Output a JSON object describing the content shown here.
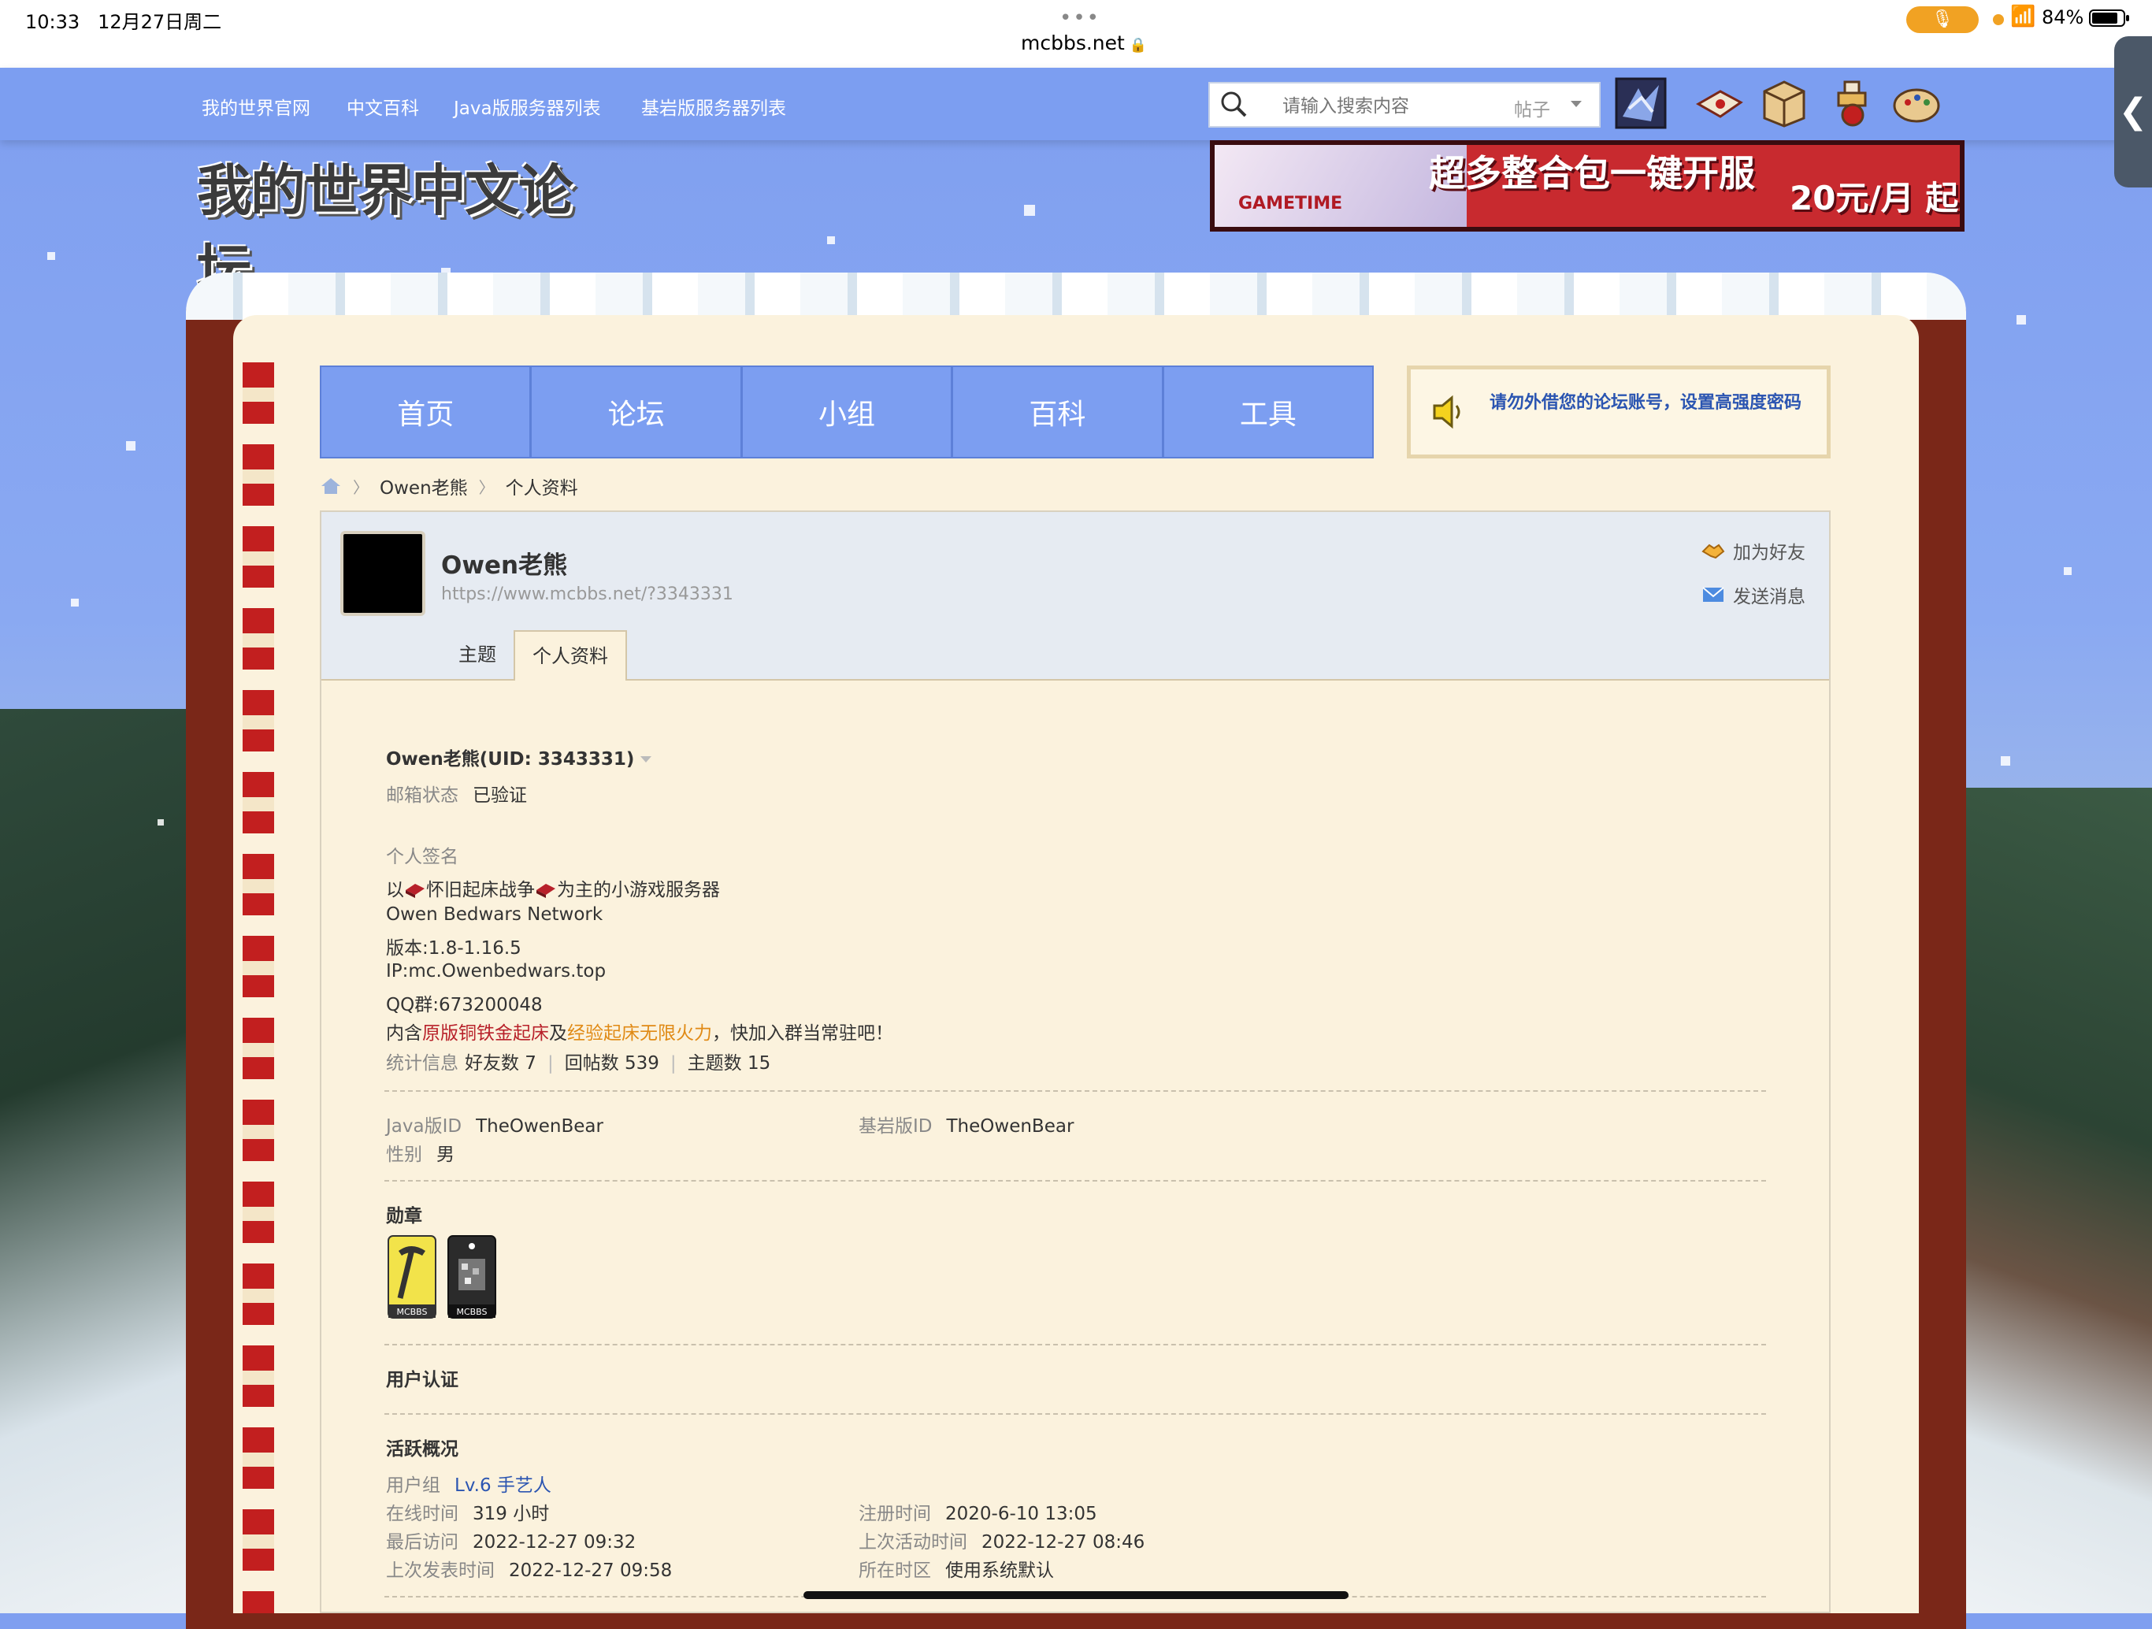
{
  "status_bar": {
    "time": "10:33",
    "date": "12月27日周二",
    "url": "mcbbs.net",
    "battery": "84%",
    "battery_fraction": 0.84
  },
  "top_nav": {
    "links": [
      "我的世界官网",
      "中文百科",
      "Java版服务器列表",
      "基岩版服务器列表"
    ],
    "search_placeholder": "请输入搜索内容",
    "search_type": "帖子"
  },
  "side_tab_glyph": "❮",
  "logo_text": "我的世界中文论坛",
  "banner": {
    "brand": "GAMETIME",
    "headline": "超多整合包一键开服",
    "price": "20元/月 起"
  },
  "main_tabs": [
    "首页",
    "论坛",
    "小组",
    "百科",
    "工具"
  ],
  "notice": "请勿外借您的论坛账号，设置高强度密码",
  "breadcrumb": [
    "Owen老熊",
    "个人资料"
  ],
  "profile": {
    "name": "Owen老熊",
    "url": "https://www.mcbbs.net/?3343331",
    "actions": {
      "add_friend": "加为好友",
      "send_message": "发送消息"
    },
    "tabs": [
      "主题",
      "个人资料"
    ],
    "active_tab": "个人资料",
    "uid_line": "Owen老熊(UID: 3343331)",
    "email_label": "邮箱状态",
    "email_value": "已验证",
    "signature_label": "个人签名",
    "signature": {
      "line1_a": "以",
      "line1_b": "怀旧起床战争",
      "line1_c": "为主的小游戏服务器",
      "line2": "Owen Bedwars Network",
      "line3": "版本:1.8-1.16.5",
      "line4": "IP:mc.Owenbedwars.top",
      "line5": "QQ群:673200048",
      "line6_a": "内含",
      "line6_red": "原版铜铁金起床",
      "line6_b": "及",
      "line6_orange": "经验起床无限火力",
      "line6_c": "，快加入群当常驻吧！"
    },
    "stats_label": "统计信息",
    "stats": [
      "好友数 7",
      "回帖数 539",
      "主题数 15"
    ],
    "java_label": "Java版ID",
    "java_id": "TheOwenBear",
    "bedrock_label": "基岩版ID",
    "bedrock_id": "TheOwenBear",
    "gender_label": "性别",
    "gender": "男",
    "medals_title": "勋章",
    "medal_caption": "MCBBS",
    "cert_title": "用户认证",
    "activity_title": "活跃概况",
    "group_label": "用户组",
    "group_value": "Lv.6 手艺人",
    "online_label": "在线时间",
    "online_value": "319 小时",
    "reg_label": "注册时间",
    "reg_value": "2020-6-10 13:05",
    "last_visit_label": "最后访问",
    "last_visit_value": "2022-12-27 09:32",
    "last_active_label": "上次活动时间",
    "last_active_value": "2022-12-27 08:46",
    "last_post_label": "上次发表时间",
    "last_post_value": "2022-12-27 09:58",
    "tz_label": "所在时区",
    "tz_value": "使用系统默认"
  },
  "colors": {
    "nav_blue": "#7c9ef1",
    "frame_red": "#7a2718",
    "page_cream": "#fbf2dd",
    "link_blue": "#2b55b1",
    "sig_red": "#b8212a",
    "sig_orange": "#e08a15"
  },
  "icons": [
    "search-icon",
    "home-icon",
    "speaker-icon",
    "handshake-icon",
    "mail-icon",
    "bed-icon",
    "pickaxe-medal-icon",
    "ore-medal-icon"
  ]
}
